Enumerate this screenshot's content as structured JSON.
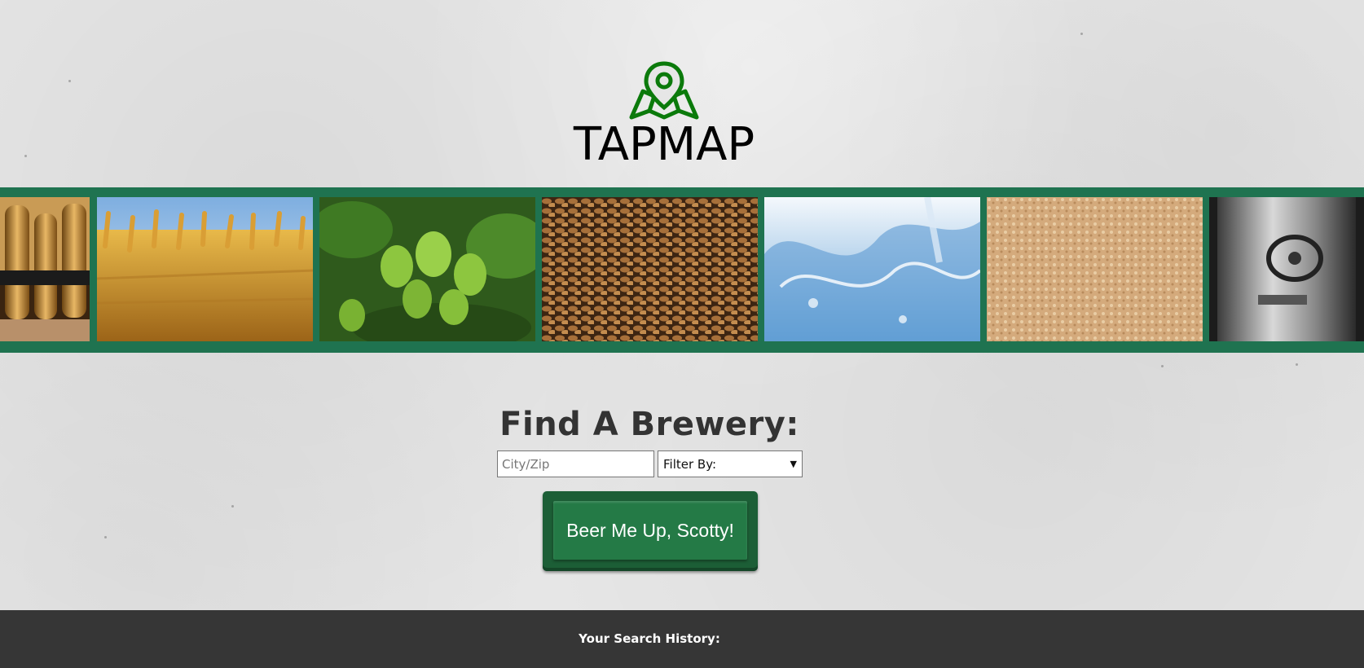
{
  "header": {
    "logo_text": "TAPMAP",
    "logo_icon": "map-pin-icon",
    "brand_color": "#0b7a0b"
  },
  "strip": {
    "background_color": "#1f7350",
    "images": [
      "beer-taps-image",
      "wheat-field-image",
      "hops-image",
      "malted-barley-image",
      "water-splash-image",
      "yeast-image",
      "brewing-tank-image"
    ]
  },
  "search": {
    "title": "Find A Brewery:",
    "city_placeholder": "City/Zip",
    "filter_selected": "Filter By:",
    "submit_label": "Beer Me Up, Scotty!",
    "button_color": "#247a46"
  },
  "footer": {
    "history_label": "Your Search History:",
    "background_color": "#363636"
  }
}
